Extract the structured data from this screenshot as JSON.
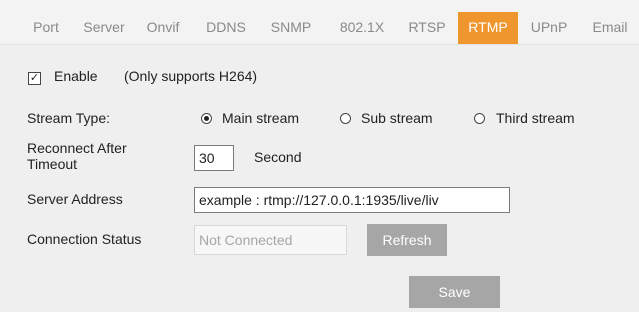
{
  "tabs": [
    {
      "label": "Port"
    },
    {
      "label": "Server"
    },
    {
      "label": "Onvif"
    },
    {
      "label": "DDNS"
    },
    {
      "label": "SNMP"
    },
    {
      "label": "802.1X"
    },
    {
      "label": "RTSP"
    },
    {
      "label": "RTMP",
      "active": true
    },
    {
      "label": "UPnP"
    },
    {
      "label": "Email"
    }
  ],
  "colors": {
    "active_tab": "#f0962f",
    "button": "#a6a6a6"
  },
  "enable": {
    "checked": true,
    "label": "Enable",
    "note": "(Only supports H264)"
  },
  "stream_type": {
    "label": "Stream Type:",
    "options": [
      {
        "label": "Main stream",
        "selected": true
      },
      {
        "label": "Sub stream",
        "selected": false
      },
      {
        "label": "Third stream",
        "selected": false
      }
    ]
  },
  "reconnect": {
    "label_line1": "Reconnect After",
    "label_line2": "Timeout",
    "value": "30",
    "unit": "Second"
  },
  "server_address": {
    "label": "Server Address",
    "value": "example : rtmp://127.0.0.1:1935/live/liv"
  },
  "connection_status": {
    "label": "Connection Status",
    "value": "Not Connected",
    "refresh_label": "Refresh"
  },
  "save_label": "Save"
}
